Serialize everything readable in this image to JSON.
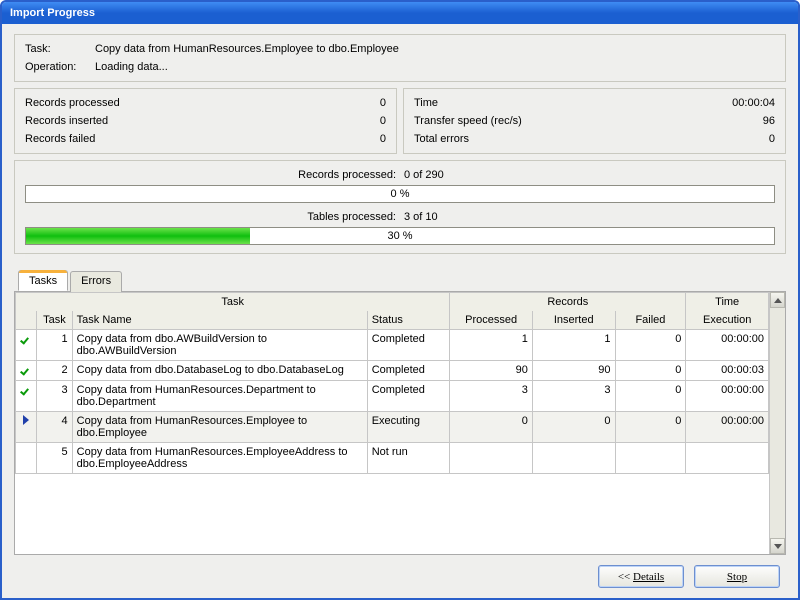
{
  "window": {
    "title": "Import Progress"
  },
  "task_panel": {
    "task_label": "Task:",
    "task_value": "Copy data from HumanResources.Employee to dbo.Employee",
    "operation_label": "Operation:",
    "operation_value": "Loading data..."
  },
  "stats_left": {
    "processed_label": "Records processed",
    "processed_value": "0",
    "inserted_label": "Records inserted",
    "inserted_value": "0",
    "failed_label": "Records failed",
    "failed_value": "0"
  },
  "stats_right": {
    "time_label": "Time",
    "time_value": "00:00:04",
    "speed_label": "Transfer speed (rec/s)",
    "speed_value": "96",
    "errors_label": "Total errors",
    "errors_value": "0"
  },
  "progress": {
    "records_caption_l": "Records processed:",
    "records_caption_r": "0 of 290",
    "records_pct_text": "0 %",
    "records_pct": 0,
    "tables_caption_l": "Tables processed:",
    "tables_caption_r": "3 of 10",
    "tables_pct_text": "30 %",
    "tables_pct": 30
  },
  "tabs": {
    "tasks": "Tasks",
    "errors": "Errors"
  },
  "grid": {
    "headers": {
      "task_group": "Task",
      "records_group": "Records",
      "time_group": "Time",
      "task_idx": "Task",
      "task_name": "Task Name",
      "status": "Status",
      "processed": "Processed",
      "inserted": "Inserted",
      "failed": "Failed",
      "execution": "Execution"
    },
    "rows": [
      {
        "state": "done",
        "idx": "1",
        "name": "Copy data from dbo.AWBuildVersion to dbo.AWBuildVersion",
        "status": "Completed",
        "processed": "1",
        "inserted": "1",
        "failed": "0",
        "exec": "00:00:00"
      },
      {
        "state": "done",
        "idx": "2",
        "name": "Copy data from dbo.DatabaseLog to dbo.DatabaseLog",
        "status": "Completed",
        "processed": "90",
        "inserted": "90",
        "failed": "0",
        "exec": "00:00:03"
      },
      {
        "state": "done",
        "idx": "3",
        "name": "Copy data from HumanResources.Department to dbo.Department",
        "status": "Completed",
        "processed": "3",
        "inserted": "3",
        "failed": "0",
        "exec": "00:00:00"
      },
      {
        "state": "exec",
        "idx": "4",
        "name": "Copy data from HumanResources.Employee to dbo.Employee",
        "status": "Executing",
        "processed": "0",
        "inserted": "0",
        "failed": "0",
        "exec": "00:00:00"
      },
      {
        "state": "none",
        "idx": "5",
        "name": "Copy data from HumanResources.EmployeeAddress to dbo.EmployeeAddress",
        "status": "Not run",
        "processed": "",
        "inserted": "",
        "failed": "",
        "exec": ""
      }
    ]
  },
  "buttons": {
    "details_prefix": "<< ",
    "details": "Details",
    "stop": "Stop"
  }
}
